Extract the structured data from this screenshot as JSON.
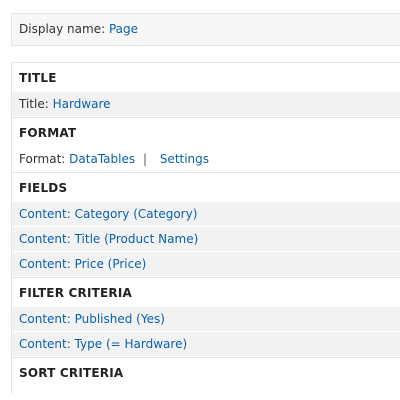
{
  "display": {
    "label": "Display name:",
    "value": "Page"
  },
  "sections": {
    "title": {
      "header": "TITLE",
      "label": "Title:",
      "value": "Hardware"
    },
    "format": {
      "header": "FORMAT",
      "label": "Format:",
      "value": "DataTables",
      "separator": "|",
      "settings": "Settings"
    },
    "fields": {
      "header": "FIELDS",
      "items": [
        "Content: Category (Category)",
        "Content: Title (Product Name)",
        "Content: Price (Price)"
      ]
    },
    "filter": {
      "header": "FILTER CRITERIA",
      "items": [
        "Content: Published (Yes)",
        "Content: Type (= Hardware)"
      ]
    },
    "sort": {
      "header": "SORT CRITERIA"
    }
  },
  "colors": {
    "link": "#0a60ad",
    "text": "#333333",
    "row_background": "#f2f2f2",
    "border": "#e4e4e4"
  }
}
